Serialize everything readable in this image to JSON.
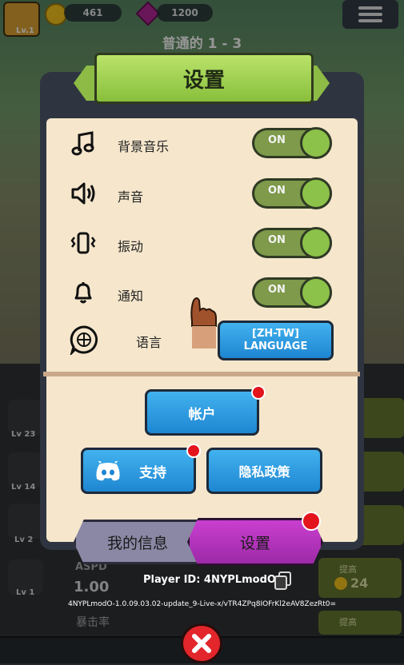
{
  "hud": {
    "level": "Lv.1",
    "coins": "461",
    "gems": "1200",
    "stage": "普通的 1 - 3"
  },
  "dialog": {
    "title": "设置",
    "settings": [
      {
        "label": "背景音乐",
        "state": "ON",
        "icon": "music-note-icon"
      },
      {
        "label": "声音",
        "state": "ON",
        "icon": "speaker-icon"
      },
      {
        "label": "振动",
        "state": "ON",
        "icon": "vibrate-icon"
      },
      {
        "label": "通知",
        "state": "ON",
        "icon": "bell-icon"
      }
    ],
    "language": {
      "label": "语言",
      "button_line1": "[ZH-TW]",
      "button_line2": "LANGUAGE",
      "icon": "globe-chat-icon"
    },
    "account_button": "帐户",
    "support_button": "支持",
    "privacy_button": "隐私政策",
    "tabs": {
      "profile": "我的信息",
      "settings": "设置"
    },
    "player_id": "Player ID: 4NYPLmodO",
    "version": "4NYPLmodO-1.0.09.03.02-update_9-Live-x/vTR4ZPq8IOFrKl2eAV8ZezRt0="
  },
  "background": {
    "stats": [
      {
        "level": "Lv 23"
      },
      {
        "level": "Lv 14"
      },
      {
        "level": "Lv 2"
      },
      {
        "level": "Lv 1"
      }
    ],
    "aspd_label": "ASPD",
    "aspd_value": "1.00",
    "crit_label": "暴击率",
    "upgrade_label": "提高",
    "upgrade_cost": "24"
  },
  "colors": {
    "accent_green": "#8dbb46",
    "button_blue": "#2a96e0",
    "tab_purple": "#b534b5",
    "notify_red": "#e3141c"
  }
}
